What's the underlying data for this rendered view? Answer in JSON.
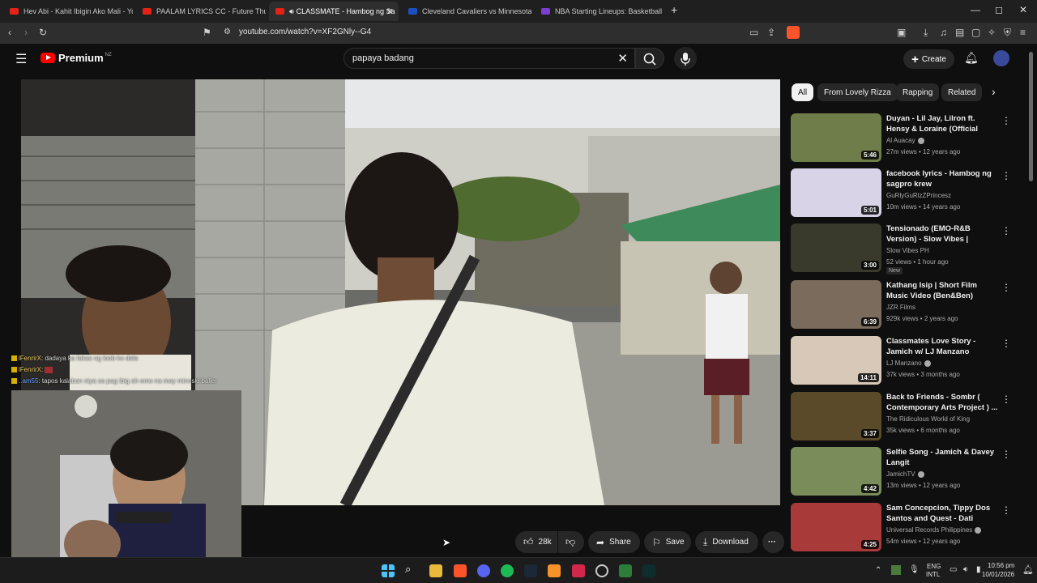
{
  "browser": {
    "tabs": [
      {
        "title": "Hev Abi - Kahit Ibigin Ako Mali - You",
        "active": false
      },
      {
        "title": "PAALAM LYRICS CC - Future Thug ft.",
        "active": false
      },
      {
        "title": "CLASSMATE - Hambog ng Sa",
        "active": true
      },
      {
        "title": "Cleveland Cavaliers vs Minnesota Tim",
        "active": false
      },
      {
        "title": "NBA Starting Lineups: Basketball Dai",
        "active": false
      }
    ],
    "new_tab": "+",
    "url": "youtube.com/watch?v=XF2GNly--G4",
    "window_controls": {
      "minimize": "—",
      "maximize": "◻",
      "close": "✕"
    }
  },
  "header": {
    "logo_text": "Premium",
    "country": "NZ",
    "search_value": "papaya badang",
    "create_label": "Create"
  },
  "player": {
    "chat_overlay": [
      {
        "user": "lFenrirX",
        "text": ": dadaya ka fakas ng loob ko dala"
      },
      {
        "user": "lFenrirX",
        "text": ":"
      },
      {
        "user": "..am55",
        "text": ": tapos kalaban niya sa pag ibig ah emo na may mineski baller"
      }
    ]
  },
  "actions": {
    "like_count": "28k",
    "share_label": "Share",
    "save_label": "Save",
    "download_label": "Download"
  },
  "chips": [
    "All",
    "From Lovely Rizza",
    "Rapping",
    "Related"
  ],
  "recommendations": [
    {
      "title": "Duyan - Lil Jay, Lilron ft. Hensy & Loraine (Official Music Video)",
      "channel": "Al Auacay",
      "verified": true,
      "meta": "27m views • 12 years ago",
      "duration": "5:46",
      "thumb_color": "#6f7d4a"
    },
    {
      "title": "facebook lyrics - Hambog ng sagpro krew",
      "channel": "GuRlyGuRlzZPrincesz",
      "verified": false,
      "meta": "10m views • 14 years ago",
      "duration": "5:01",
      "thumb_color": "#d9d3e8"
    },
    {
      "title": "Tensionado (EMO-R&B Version) - Slow Vibes | Soapdish",
      "channel": "Slow Vibes PH",
      "verified": false,
      "meta": "52 views • 1 hour ago",
      "duration": "3:00",
      "thumb_color": "#3a3a2c",
      "badge": "New"
    },
    {
      "title": "Kathang Isip | Short Film Music Video (Ben&Ben)",
      "channel": "JZR Films",
      "verified": false,
      "meta": "929k views • 2 years ago",
      "duration": "6:39",
      "thumb_color": "#7a6b5c"
    },
    {
      "title": "Classmates Love Story - Jamich w/ LJ Manzano (Original Re-...",
      "channel": "LJ Manzano",
      "verified": true,
      "meta": "37k views • 3 months ago",
      "duration": "14:11",
      "thumb_color": "#d8c8b8"
    },
    {
      "title": "Back to Friends - Sombr ( Contemporary Arts Project ) ...",
      "channel": "The Ridiculous World of King",
      "verified": false,
      "meta": "35k views • 6 months ago",
      "duration": "3:37",
      "thumb_color": "#5a4a2a"
    },
    {
      "title": "Selfie Song - Jamich & Davey Langit",
      "channel": "JamichTV",
      "verified": true,
      "meta": "13m views • 12 years ago",
      "duration": "4:42",
      "thumb_color": "#7a8c5a"
    },
    {
      "title": "Sam Concepcion, Tippy Dos Santos and Quest - Dati (Offici...",
      "channel": "Universal Records Philippines",
      "verified": true,
      "meta": "54m views • 12 years ago",
      "duration": "4:25",
      "thumb_color": "#a83a3a"
    }
  ],
  "taskbar": {
    "lang_top": "ENG",
    "lang_bottom": "INTL",
    "time": "10:56 pm",
    "date": "10/01/2026"
  },
  "icons": {
    "back": "back-icon",
    "forward": "forward-icon",
    "reload": "reload-icon",
    "bookmark": "bookmark-icon",
    "menu": "hamburger-menu-icon",
    "search": "search-icon",
    "mic": "microphone-icon",
    "bell": "bell-icon",
    "like": "thumbs-up-icon",
    "dislike": "thumbs-down-icon"
  },
  "colors": {
    "accent": "#ff0000",
    "background": "#0f0f0f",
    "chip_selected": "#f1f1f1"
  }
}
